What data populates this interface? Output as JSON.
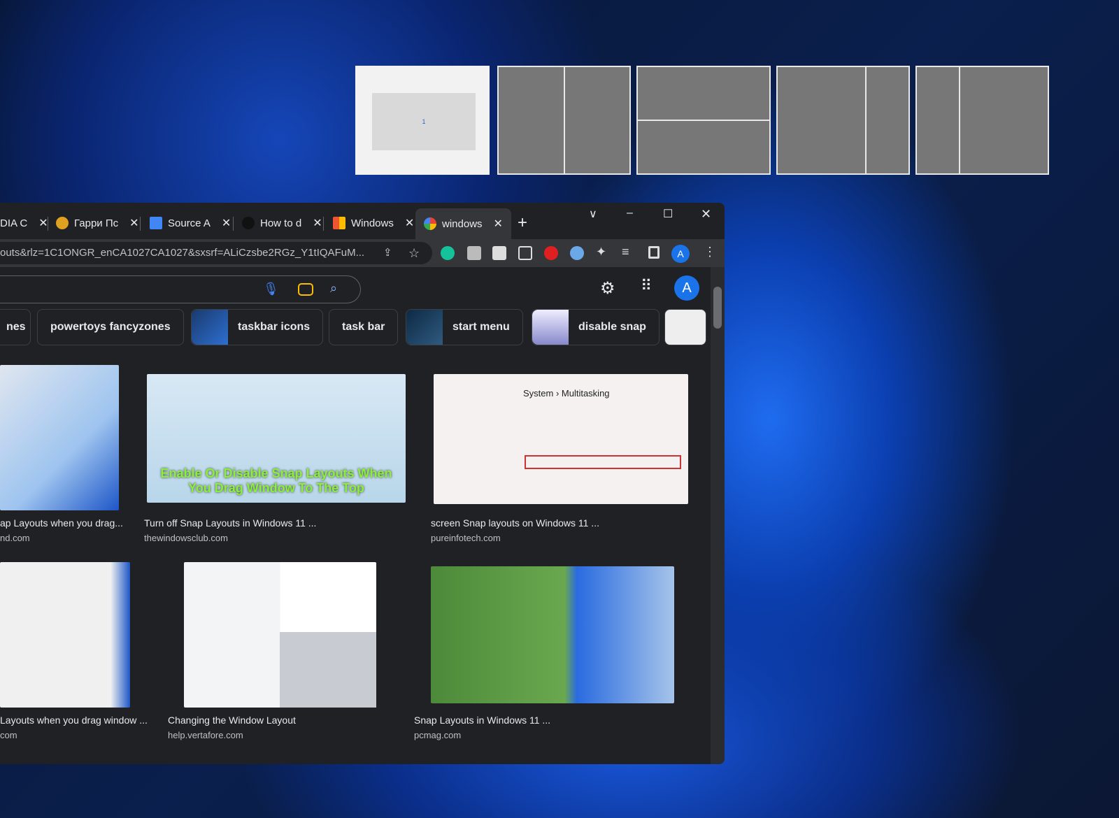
{
  "snap_layouts": {
    "zone_label": "1",
    "options": [
      "full",
      "two-columns",
      "two-rows",
      "wide-left",
      "wide-right"
    ]
  },
  "browser": {
    "tabs": [
      {
        "label": "DIA C"
      },
      {
        "label": "Гарри Пс"
      },
      {
        "label": "Source A"
      },
      {
        "label": "How to d"
      },
      {
        "label": "Windows"
      },
      {
        "label": "windows",
        "active": true
      }
    ],
    "new_tab": "+",
    "controls": {
      "tab_search": "∨",
      "minimize": "–",
      "maximize": "☐",
      "close": "✕"
    },
    "url": "outs&rlz=1C1ONGR_enCA1027CA1027&sxsrf=ALiCzsbe2RGz_Y1tIQAFuM...",
    "profile_initial": "A",
    "chips": [
      {
        "label": "nes"
      },
      {
        "label": "powertoys fancyzones"
      },
      {
        "label": "taskbar icons"
      },
      {
        "label": "task bar"
      },
      {
        "label": "start menu"
      },
      {
        "label": "disable snap"
      }
    ],
    "results": [
      {
        "caption": "ap Layouts when you drag...",
        "source": "nd.com"
      },
      {
        "caption": "Turn off Snap Layouts in Windows 11 ...",
        "source": "thewindowsclub.com",
        "overlay": "Enable Or Disable Snap Layouts When You Drag Window To The Top"
      },
      {
        "caption": "screen Snap layouts on Windows 11 ...",
        "source": "pureinfotech.com",
        "overlay": "System › Multitasking"
      },
      {
        "caption": "Layouts when you drag window ...",
        "source": "com"
      },
      {
        "caption": "Changing the Window Layout",
        "source": "help.vertafore.com"
      },
      {
        "caption": "Snap Layouts in Windows 11 ...",
        "source": "pcmag.com"
      }
    ]
  },
  "colors": {
    "accent": "#1a73e8",
    "chrome_bg": "#202124",
    "toolbar": "#35363a"
  }
}
